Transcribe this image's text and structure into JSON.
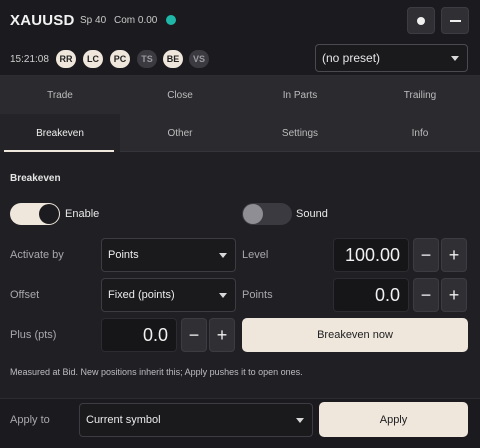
{
  "header": {
    "symbol": "XAUUSD",
    "spread": "Sp 40",
    "commission": "Com 0.00",
    "status_color": "#1fb8a8"
  },
  "toolbar": {
    "time": "15:21:08",
    "pills": [
      {
        "label": "RR",
        "active": true
      },
      {
        "label": "LC",
        "active": true
      },
      {
        "label": "PC",
        "active": true
      },
      {
        "label": "TS",
        "active": false
      },
      {
        "label": "BE",
        "active": true
      },
      {
        "label": "VS",
        "active": false
      }
    ],
    "preset": "(no preset)"
  },
  "tabs_row1": [
    "Trade",
    "Close",
    "In Parts",
    "Trailing"
  ],
  "tabs_row2": [
    "Breakeven",
    "Other",
    "Settings",
    "Info"
  ],
  "active_tab": "Breakeven",
  "breakeven": {
    "section_title": "Breakeven",
    "enable_label": "Enable",
    "enable_on": true,
    "sound_label": "Sound",
    "sound_on": false,
    "activate_label": "Activate by",
    "activate_value": "Points",
    "level_label": "Level",
    "level_value": "100.00",
    "offset_label": "Offset",
    "offset_value": "Fixed (points)",
    "points_label": "Points",
    "points_value": "0.0",
    "plus_label": "Plus (pts)",
    "plus_value": "0.0",
    "breakeven_now": "Breakeven now",
    "note": "Measured at Bid. New positions inherit this; Apply pushes it to open ones."
  },
  "footer": {
    "apply_to_label": "Apply to",
    "apply_to_value": "Current symbol",
    "apply_button": "Apply"
  },
  "icons": {
    "minus": "−",
    "plus": "+"
  },
  "colors": {
    "accent": "#efe7dc",
    "status": "#1fb8a8",
    "background": "#202024"
  }
}
